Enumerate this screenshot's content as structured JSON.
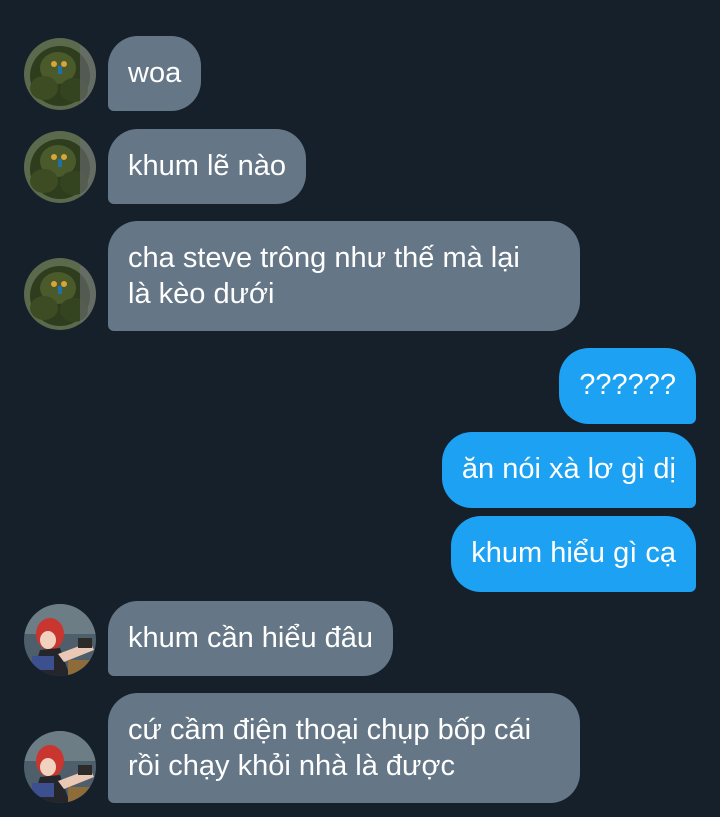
{
  "conversation": {
    "messages": [
      {
        "direction": "incoming",
        "lines": [
          "woa"
        ]
      },
      {
        "direction": "incoming",
        "lines": [
          "khum lẽ nào"
        ]
      },
      {
        "direction": "incoming",
        "lines": [
          "cha steve trông như thế mà lại",
          "là kèo dưới"
        ]
      },
      {
        "direction": "outgoing",
        "lines": [
          "??????"
        ]
      },
      {
        "direction": "outgoing",
        "lines": [
          "ăn nói xà lơ gì dị"
        ]
      },
      {
        "direction": "outgoing",
        "lines": [
          "khum hiểu gì cạ"
        ]
      },
      {
        "direction": "incoming",
        "lines": [
          "khum cần hiểu đâu"
        ]
      },
      {
        "direction": "incoming",
        "lines": [
          "cứ cầm điện thoại chụp bốp cái",
          "rồi chạy khỏi nhà là được"
        ]
      }
    ]
  },
  "colors": {
    "background": "#16202b",
    "incoming_bubble": "#657786",
    "outgoing_bubble": "#1da1f2",
    "text": "#ffffff"
  },
  "avatars": {
    "sender_a_icon": "green-hulk-avatar-icon",
    "sender_b_icon": "red-hair-cartoon-avatar-icon"
  }
}
